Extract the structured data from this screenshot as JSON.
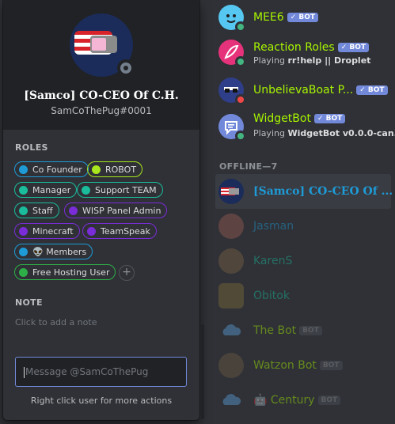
{
  "profile": {
    "name": "[Samco] CO-CEO Of C.H.",
    "tag": "SamCoThePug#0001"
  },
  "roles_section": {
    "title": "ROLES",
    "roles": [
      {
        "label": "Co Founder",
        "color": "#1e9bd7"
      },
      {
        "label": "ROBOT",
        "color": "#a8e61d"
      },
      {
        "label": "Manager",
        "color": "#1abc9c"
      },
      {
        "label": "Support TEAM",
        "color": "#1abc9c"
      },
      {
        "label": "Staff",
        "color": "#1abc9c"
      },
      {
        "label": "WISP Panel Admin",
        "color": "#7a2cd8"
      },
      {
        "label": "Minecraft",
        "color": "#7a2cd8"
      },
      {
        "label": "TeamSpeak",
        "color": "#7a2cd8"
      },
      {
        "label": "👽 Members",
        "color": "#1e9bd7"
      },
      {
        "label": "Free Hosting User",
        "color": "#2eae48"
      }
    ],
    "add_icon": "+"
  },
  "note_section": {
    "title": "NOTE",
    "placeholder": "Click to add a note"
  },
  "message_box": {
    "placeholder": "Message @SamCoThePug"
  },
  "footer_hint": "Right click user for more actions",
  "members_online": [
    {
      "name": "MEE6",
      "name_color": "#a8f500",
      "bot_label": "✓ BOT",
      "status_color": "#43b581",
      "avatar_color": "#56c7f0",
      "activity_prefix": "",
      "activity_bold": ""
    },
    {
      "name": "Reaction Roles",
      "name_color": "#a8f500",
      "bot_label": "✓ BOT",
      "status_color": "#43b581",
      "avatar_color": "#e6327a",
      "activity_prefix": "Playing ",
      "activity_bold": "rr!help || Droplet"
    },
    {
      "name": "UnbelievaBoat P...",
      "name_color": "#a8f500",
      "bot_label": "✓ BOT",
      "status_color": "#f04747",
      "avatar_color": "#2f3e88",
      "activity_prefix": "",
      "activity_bold": ""
    },
    {
      "name": "WidgetBot",
      "name_color": "#a8f500",
      "bot_label": "✓ BOT",
      "status_color": "#43b581",
      "avatar_color": "#7289da",
      "activity_prefix": "Playing ",
      "activity_bold": "WidgetBot v0.0.0-can..."
    }
  ],
  "offline_group": {
    "label": "OFFLINE—7"
  },
  "members_offline": [
    {
      "name": "[Samco] CO-CEO Of ...",
      "name_color": "#1e9bd7",
      "bot_label": "",
      "avatar_color": "#1b2c5a"
    },
    {
      "name": "Jasman",
      "name_color": "#1e9bd7",
      "bot_label": "",
      "avatar_color": "#9a5a55"
    },
    {
      "name": "KarenS",
      "name_color": "#1abc9c",
      "bot_label": "",
      "avatar_color": "#7a6244"
    },
    {
      "name": "Obitok",
      "name_color": "#1abc9c",
      "bot_label": "",
      "avatar_color": "#7d6a3a"
    },
    {
      "name": "The Bot",
      "name_color": "#a8f500",
      "bot_label": "BOT",
      "avatar_color": "#5b9bd5"
    },
    {
      "name": "Watzon Bot",
      "name_color": "#a8f500",
      "bot_label": "BOT",
      "avatar_color": "#6b5a45"
    },
    {
      "name": "🤖 Century",
      "name_color": "#a8f500",
      "bot_label": "BOT",
      "avatar_color": "#5b9bd5"
    }
  ]
}
